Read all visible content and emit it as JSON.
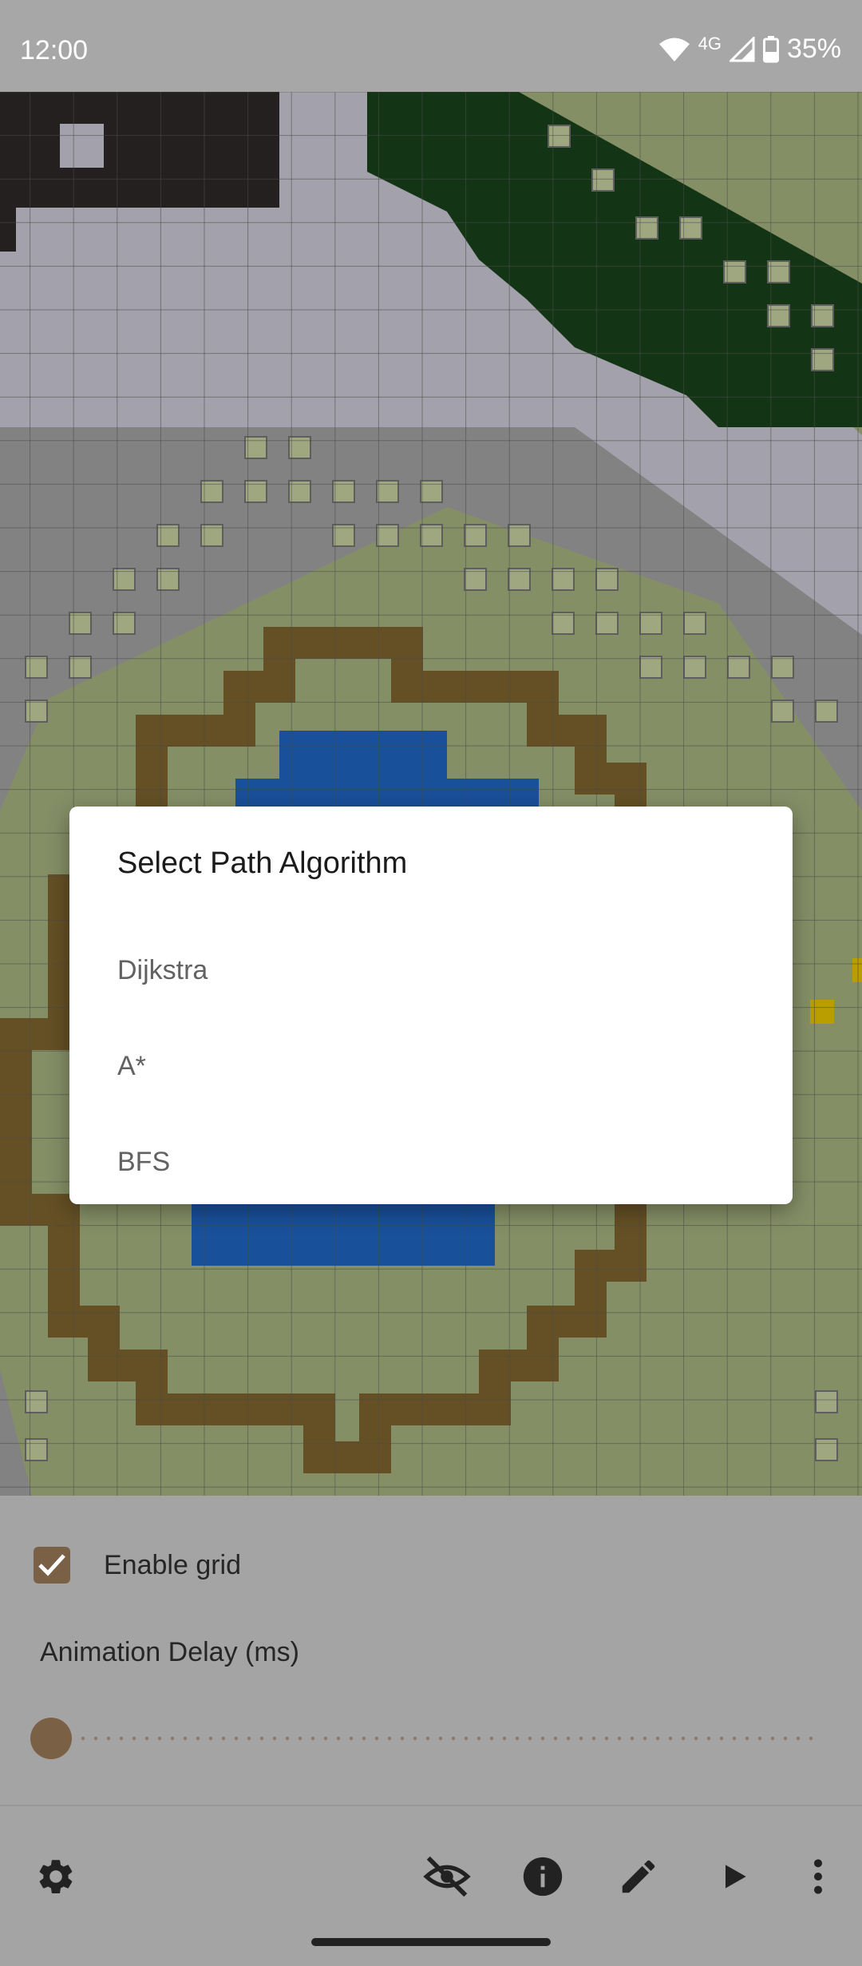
{
  "status_bar": {
    "time": "12:00",
    "network": "4G",
    "battery": "35%",
    "icons": [
      "wifi-icon",
      "signal-icon",
      "battery-icon"
    ]
  },
  "grid": {
    "icon_name": "pathfinding-grid"
  },
  "dialog": {
    "title": "Select Path Algorithm",
    "options": [
      "Dijkstra",
      "A*",
      "BFS"
    ]
  },
  "settings": {
    "enable_grid_label": "Enable grid",
    "enable_grid_checked": true,
    "animation_delay_label": "Animation Delay (ms)",
    "animation_delay_value": 0
  },
  "toolbar": {
    "icons": [
      "settings-icon",
      "visibility-off-icon",
      "info-icon",
      "edit-icon",
      "play-icon",
      "more-vert-icon"
    ]
  },
  "colors": {
    "accent": "#7a6145",
    "grass": "#98a375",
    "tree": "#173d18",
    "mountain": "#bab8c3",
    "rock": "#959595",
    "wall": "#2a2525",
    "water": "#1d5cb0",
    "sand": "#735c2b",
    "goal": "#d4b400"
  }
}
